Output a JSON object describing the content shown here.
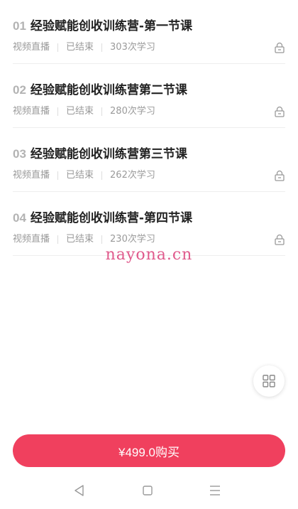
{
  "lessons": [
    {
      "num": "01",
      "title": "经验赋能创收训练营-第一节课",
      "type": "视频直播",
      "status": "已结束",
      "learners": "303次学习",
      "icon": "lock-icon"
    },
    {
      "num": "02",
      "title": "经验赋能创收训练营第二节课",
      "type": "视频直播",
      "status": "已结束",
      "learners": "280次学习",
      "icon": "lock-icon"
    },
    {
      "num": "03",
      "title": "经验赋能创收训练营第三节课",
      "type": "视频直播",
      "status": "已结束",
      "learners": "262次学习",
      "icon": "lock-icon"
    },
    {
      "num": "04",
      "title": "经验赋能创收训练营-第四节课",
      "type": "视频直播",
      "status": "已结束",
      "learners": "230次学习",
      "icon": "lock-icon"
    }
  ],
  "watermark": "nayona.cn",
  "float_button": {
    "icon": "grid-icon"
  },
  "buy": {
    "label": "¥499.0购买"
  },
  "navbar": {
    "icons": [
      "back-triangle-icon",
      "home-square-icon",
      "menu-lines-icon"
    ]
  },
  "colors": {
    "accent": "#f0405e",
    "watermark": "#e05a8c",
    "meta": "#9a9a9a"
  }
}
